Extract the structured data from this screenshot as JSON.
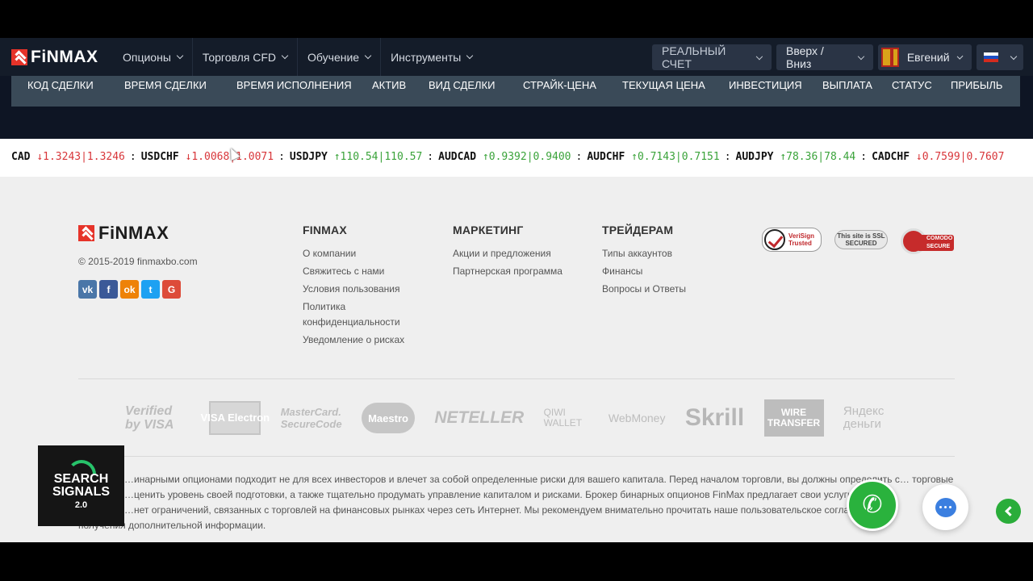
{
  "navbar": {
    "brand": "FiNMAX",
    "menu": [
      {
        "label": "Опционы"
      },
      {
        "label": "Торговля CFD"
      },
      {
        "label": "Обучение"
      },
      {
        "label": "Инструменты"
      }
    ],
    "account_type": "РЕАЛЬНЫЙ СЧЕТ",
    "trade_mode": "Вверх / Вниз",
    "user_name": "Евгений",
    "language_flag": "ru"
  },
  "trades_table": {
    "columns": [
      "КОД СДЕЛКИ",
      "ВРЕМЯ СДЕЛКИ",
      "ВРЕМЯ ИСПОЛНЕНИЯ",
      "АКТИВ",
      "ВИД СДЕЛКИ",
      "СТРАЙК-ЦЕНА",
      "ТЕКУЩАЯ ЦЕНА",
      "ИНВЕСТИЦИЯ",
      "ВЫПЛАТА",
      "СТАТУС",
      "ПРИБЫЛЬ"
    ]
  },
  "ticker": [
    {
      "symbol": "CAD",
      "arrow": "↓",
      "quote": "1.3243|1.3246",
      "dir": "down"
    },
    {
      "symbol": "USDCHF",
      "arrow": "↓",
      "quote": "1.0068|1.0071",
      "dir": "down"
    },
    {
      "symbol": "USDJPY",
      "arrow": "↑",
      "quote": "110.54|110.57",
      "dir": "up"
    },
    {
      "symbol": "AUDCAD",
      "arrow": "↑",
      "quote": "0.9392|0.9400",
      "dir": "up"
    },
    {
      "symbol": "AUDCHF",
      "arrow": "↑",
      "quote": "0.7143|0.7151",
      "dir": "up"
    },
    {
      "symbol": "AUDJPY",
      "arrow": "↑",
      "quote": "78.36|78.44",
      "dir": "up"
    },
    {
      "symbol": "CADCHF",
      "arrow": "↓",
      "quote": "0.7599|0.7607",
      "dir": "down"
    }
  ],
  "footer": {
    "brand": "FiNMAX",
    "copyright": "© 2015-2019 finmaxbo.com",
    "socials": [
      {
        "name": "vk-icon",
        "glyph": "vk",
        "color": "#4a76a8"
      },
      {
        "name": "facebook-icon",
        "glyph": "f",
        "color": "#3b5998"
      },
      {
        "name": "odnoklassniki-icon",
        "glyph": "ok",
        "color": "#ee8208"
      },
      {
        "name": "twitter-icon",
        "glyph": "t",
        "color": "#1da1f2"
      },
      {
        "name": "google-icon",
        "glyph": "G",
        "color": "#dd4b39"
      }
    ],
    "columns": [
      {
        "title": "FINMAX",
        "links": [
          "О компании",
          "Свяжитесь с нами",
          "Условия пользования",
          "Политика конфиденциальности",
          "Уведомление о рисках"
        ]
      },
      {
        "title": "МАРКЕТИНГ",
        "links": [
          "Акции и предложения",
          "Партнерская программа"
        ]
      },
      {
        "title": "ТРЕЙДЕРАМ",
        "links": [
          "Типы аккаунтов",
          "Финансы",
          "Вопросы и Ответы"
        ]
      }
    ],
    "badges": {
      "verisign": "VeriSign Trusted",
      "ssl": "This site is SSL SECURED",
      "comodo": "COMODO SECURE"
    },
    "payments": [
      "Verified by VISA",
      "VISA Electron",
      "MasterCard. SecureCode",
      "Maestro",
      "NETELLER",
      "QIWI WALLET",
      "WebMoney",
      "Skrill",
      "WIRE TRANSFER",
      "Яндекс деньги"
    ],
    "disclaimer": [
      "…инарными опционами подходит не для всех инвесторов и влечет за собой определенные риски для вашего капитала. Перед началом торговли, вы должны определить с… торговые",
      "…ценить уровень своей подготовки, а также тщательно продумать управление капиталом и рисками. Брокер бинарных опционов FinMax предлагает свои услуги тольк…",
      "…нет ограничений, связанных с торговлей на финансовых рынках через сеть Интернет. Мы рекомендуем внимательно прочитать наше пользовательское соглашение…",
      "получения дополнительной информации."
    ]
  },
  "overlay": {
    "search_signals": [
      "SEARCH",
      "SIGNALS",
      "2.0"
    ]
  },
  "colors": {
    "navbar": "#141c29",
    "table_header": "#3a4a58",
    "brand_red": "#e63329",
    "down": "#d8363a",
    "up": "#3aa33a",
    "call_green": "#2ab23d",
    "chat_blue": "#3b7fe0"
  }
}
